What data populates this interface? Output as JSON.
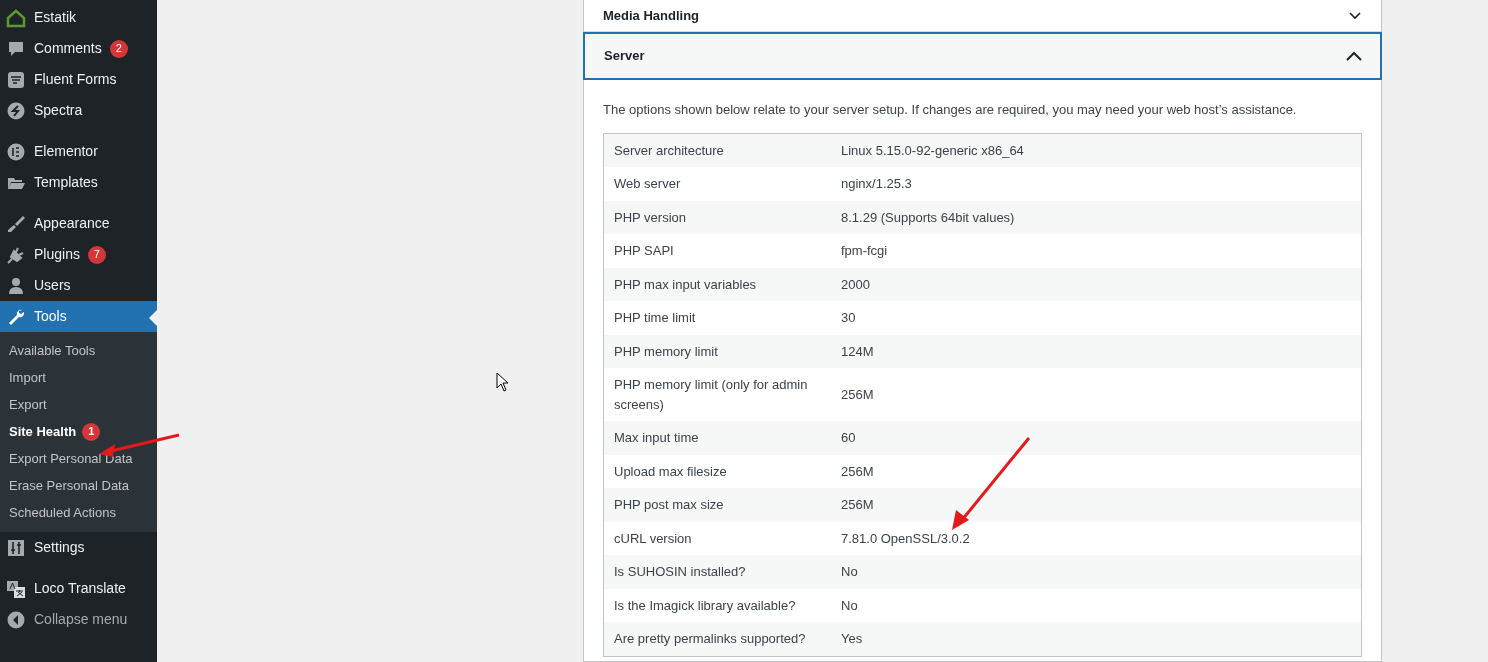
{
  "sidebar": {
    "groups": [
      [
        {
          "label": "Estatik",
          "selected": false
        },
        {
          "label": "Comments",
          "badge": "2",
          "selected": false
        },
        {
          "label": "Fluent Forms",
          "selected": false
        },
        {
          "label": "Spectra",
          "selected": false
        }
      ],
      [
        {
          "label": "Elementor",
          "selected": false
        },
        {
          "label": "Templates",
          "selected": false
        }
      ],
      [
        {
          "label": "Appearance",
          "selected": false
        },
        {
          "label": "Plugins",
          "badge": "7",
          "selected": false
        },
        {
          "label": "Users",
          "selected": false
        },
        {
          "label": "Tools",
          "selected": true,
          "children": [
            {
              "label": "Available Tools",
              "selected": false
            },
            {
              "label": "Import",
              "selected": false
            },
            {
              "label": "Export",
              "selected": false
            },
            {
              "label": "Site Health",
              "badge": "1",
              "selected": true
            },
            {
              "label": "Export Personal Data",
              "selected": false
            },
            {
              "label": "Erase Personal Data",
              "selected": false
            },
            {
              "label": "Scheduled Actions",
              "selected": false
            }
          ]
        },
        {
          "label": "Settings",
          "selected": false
        }
      ],
      [
        {
          "label": "Loco Translate",
          "selected": false
        }
      ]
    ],
    "collapse": "Collapse menu"
  },
  "sections": [
    {
      "title": "Media Handling",
      "expanded": false
    },
    {
      "title": "Server",
      "expanded": true,
      "description": "The options shown below relate to your server setup. If changes are required, you may need your web host’s assistance.",
      "rows": [
        {
          "label": "Server architecture",
          "value": "Linux 5.15.0-92-generic x86_64"
        },
        {
          "label": "Web server",
          "value": "nginx/1.25.3"
        },
        {
          "label": "PHP version",
          "value": "8.1.29 (Supports 64bit values)"
        },
        {
          "label": "PHP SAPI",
          "value": "fpm-fcgi"
        },
        {
          "label": "PHP max input variables",
          "value": "2000"
        },
        {
          "label": "PHP time limit",
          "value": "30"
        },
        {
          "label": "PHP memory limit",
          "value": "124M"
        },
        {
          "label": "PHP memory limit (only for admin screens)",
          "value": "256M"
        },
        {
          "label": "Max input time",
          "value": "60"
        },
        {
          "label": "Upload max filesize",
          "value": "256M"
        },
        {
          "label": "PHP post max size",
          "value": "256M"
        },
        {
          "label": "cURL version",
          "value": "7.81.0 OpenSSL/3.0.2"
        },
        {
          "label": "Is SUHOSIN installed?",
          "value": "No"
        },
        {
          "label": "Is the Imagick library available?",
          "value": "No"
        },
        {
          "label": "Are pretty permalinks supported?",
          "value": "Yes"
        }
      ]
    }
  ]
}
